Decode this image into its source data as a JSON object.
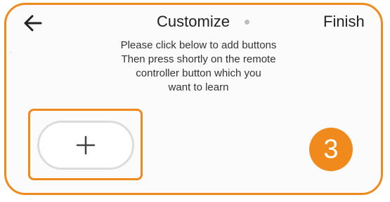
{
  "header": {
    "back_icon": "arrow-left-icon",
    "title": "Customize",
    "finish_label": "Finish"
  },
  "instructions": [
    "Please click below to add buttons",
    "Then press shortly on the remote",
    "controller button which you",
    "want to learn"
  ],
  "add_button": {
    "icon": "plus-icon"
  },
  "step_badge": "3",
  "colors": {
    "accent": "#f08a1c",
    "button_border": "#dcdcdc",
    "background": "#fbfbfb"
  }
}
